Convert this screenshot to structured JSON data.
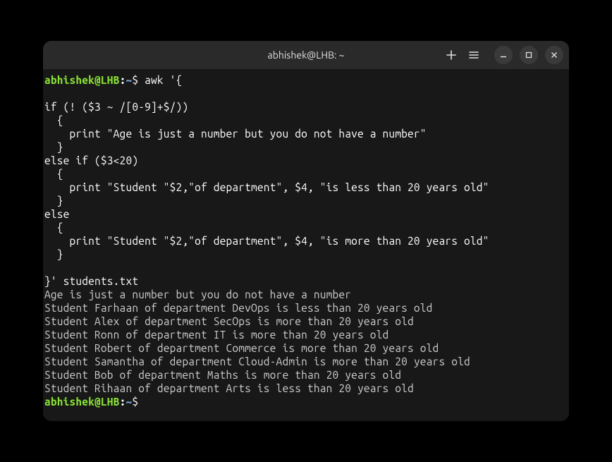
{
  "titlebar": {
    "title": "abhishek@LHB: ~"
  },
  "prompt": {
    "user_host": "abhishek@LHB",
    "separator": ":",
    "path": "~",
    "symbol": "$"
  },
  "command": {
    "l1": " awk '{",
    "l2": "",
    "l3": "if (! ($3 ~ /[0-9]+$/))",
    "l4": "  {",
    "l5": "    print \"Age is just a number but you do not have a number\"",
    "l6": "  }",
    "l7": "else if ($3<20)",
    "l8": "  {",
    "l9": "    print \"Student \"$2,\"of department\", $4, \"is less than 20 years old\"",
    "l10": "  }",
    "l11": "else",
    "l12": "  {",
    "l13": "    print \"Student \"$2,\"of department\", $4, \"is more than 20 years old\"",
    "l14": "  }",
    "l15": "",
    "l16": "}' students.txt"
  },
  "output": {
    "o1": "Age is just a number but you do not have a number",
    "o2": "Student Farhaan of department DevOps is less than 20 years old",
    "o3": "Student Alex of department SecOps is more than 20 years old",
    "o4": "Student Ronn of department IT is more than 20 years old",
    "o5": "Student Robert of department Commerce is more than 20 years old",
    "o6": "Student Samantha of department Cloud-Admin is more than 20 years old",
    "o7": "Student Bob of department Maths is more than 20 years old",
    "o8": "Student Rihaan of department Arts is less than 20 years old"
  }
}
